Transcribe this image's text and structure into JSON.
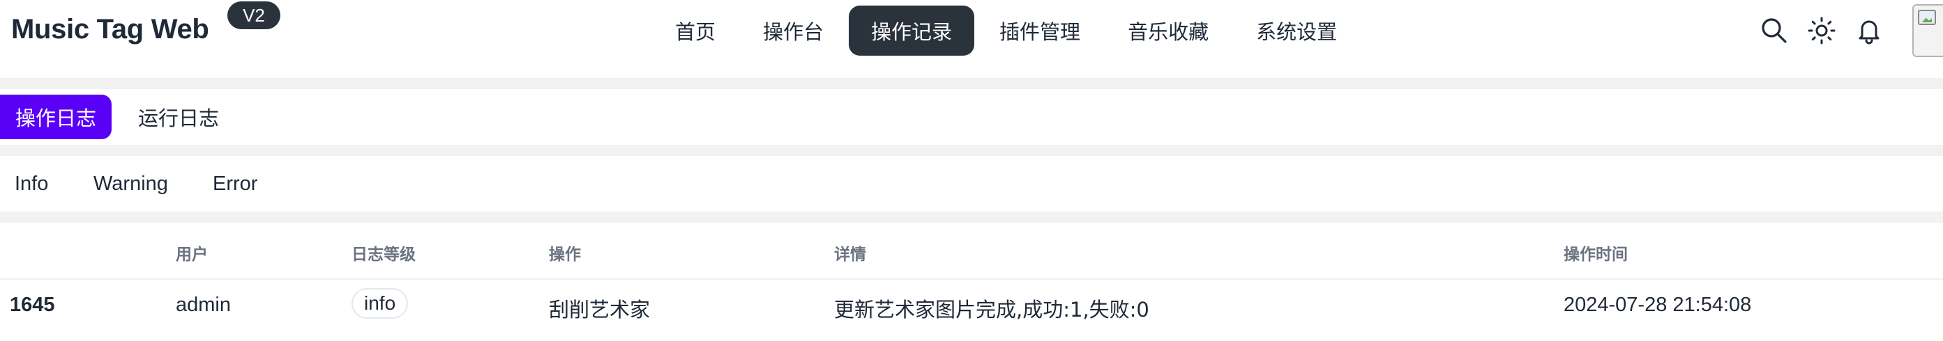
{
  "app": {
    "title": "Music Tag Web",
    "version": "V2"
  },
  "nav": {
    "items": [
      {
        "label": "首页"
      },
      {
        "label": "操作台"
      },
      {
        "label": "操作记录",
        "active": true
      },
      {
        "label": "插件管理"
      },
      {
        "label": "音乐收藏"
      },
      {
        "label": "系统设置"
      }
    ],
    "icons": [
      "search-icon",
      "sun-icon",
      "bell-icon"
    ],
    "accent_color": "#2a323c"
  },
  "log_tabs": {
    "items": [
      {
        "label": "操作日志",
        "active": true
      },
      {
        "label": "运行日志"
      }
    ],
    "active_color": "#5a00f7"
  },
  "level_filters": {
    "items": [
      {
        "label": "Info"
      },
      {
        "label": "Warning"
      },
      {
        "label": "Error"
      }
    ]
  },
  "table": {
    "columns": [
      "",
      "用户",
      "日志等级",
      "操作",
      "详情",
      "操作时间"
    ],
    "rows": [
      {
        "id": "1645",
        "user": "admin",
        "level": "info",
        "action": "刮削艺术家",
        "detail": "更新艺术家图片完成,成功:1,失败:0",
        "time": "2024-07-28 21:54:08"
      }
    ]
  }
}
